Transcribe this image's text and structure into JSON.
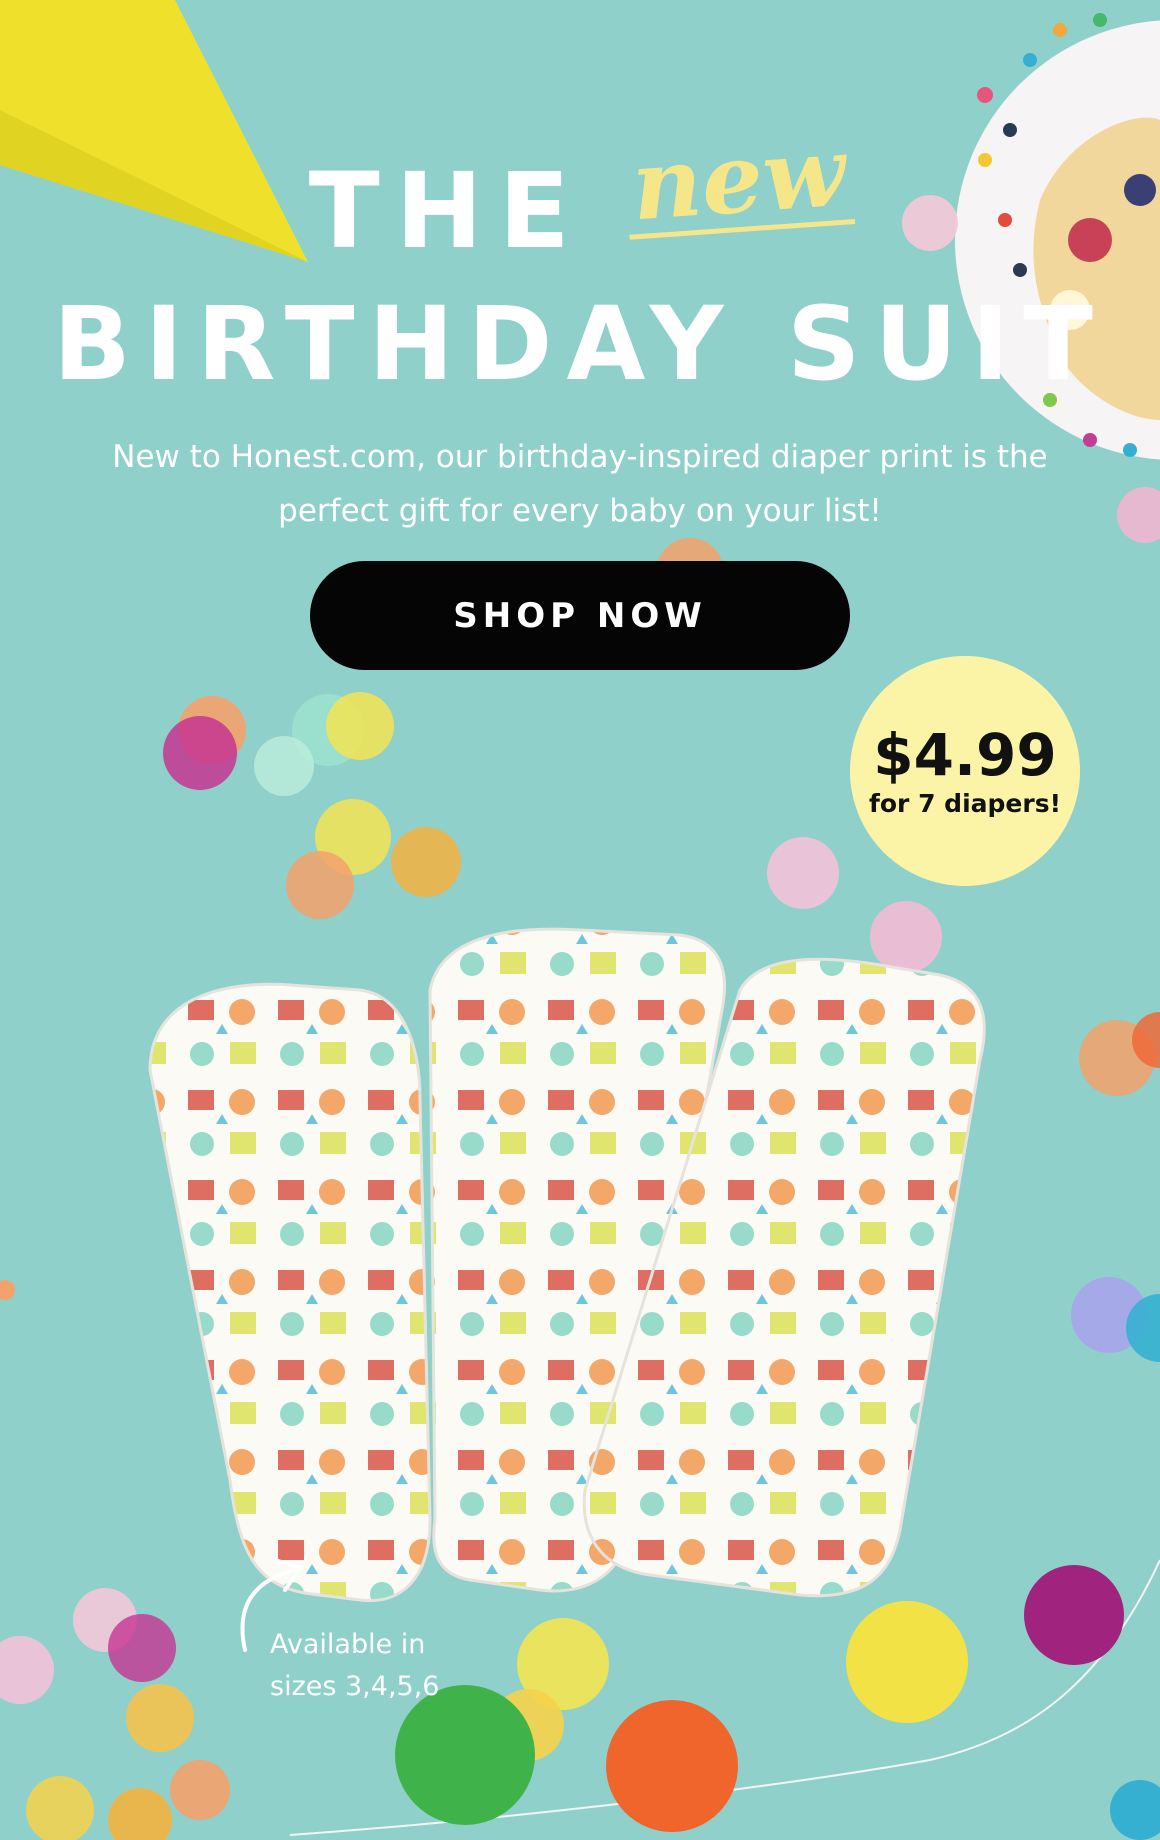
{
  "hero": {
    "title_the": "THE",
    "title_new": "new",
    "title_main": "BIRTHDAY SUIT",
    "subtitle_line1": "New to Honest.com, our birthday-inspired diaper print is the",
    "subtitle_line2": "perfect gift for every baby on your list!"
  },
  "cta": {
    "label": "SHOP NOW"
  },
  "price": {
    "amount": "$4.99",
    "note": "for 7 diapers!"
  },
  "sizes": {
    "line1": "Available in",
    "line2": "sizes 3,4,5,6"
  },
  "images": {
    "decorations": [
      "party-hat",
      "cake-slice",
      "confetti",
      "diapers",
      "arrow-icon"
    ]
  },
  "colors": {
    "background": "#8fd0cb",
    "accent_yellow": "#f5e68a",
    "button": "#050505",
    "price_badge": "#fbf4a7"
  }
}
